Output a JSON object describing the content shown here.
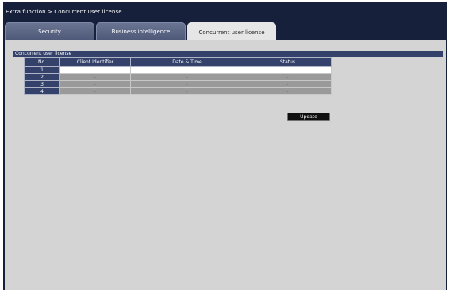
{
  "breadcrumb": "Extra function > Concurrent user license",
  "tabs": [
    {
      "label": "Security"
    },
    {
      "label": "Business intelligence"
    },
    {
      "label": "Concurrent user license"
    }
  ],
  "section_title": "Concurrent user license",
  "table": {
    "headers": [
      "No.",
      "Client Identifier",
      "Date & Time",
      "Status"
    ],
    "rows": [
      {
        "no": "1",
        "client_id": "",
        "datetime": "",
        "status": ""
      },
      {
        "no": "2",
        "client_id": "-",
        "datetime": "-",
        "status": "-"
      },
      {
        "no": "3",
        "client_id": "-",
        "datetime": "-",
        "status": "-"
      },
      {
        "no": "4",
        "client_id": "-",
        "datetime": "-",
        "status": "-"
      }
    ]
  },
  "update_label": "Update",
  "colors": {
    "frame": "#16203a",
    "header": "#34416a",
    "panel": "#d4d4d4",
    "disabled_cell": "#9a9a9a"
  }
}
